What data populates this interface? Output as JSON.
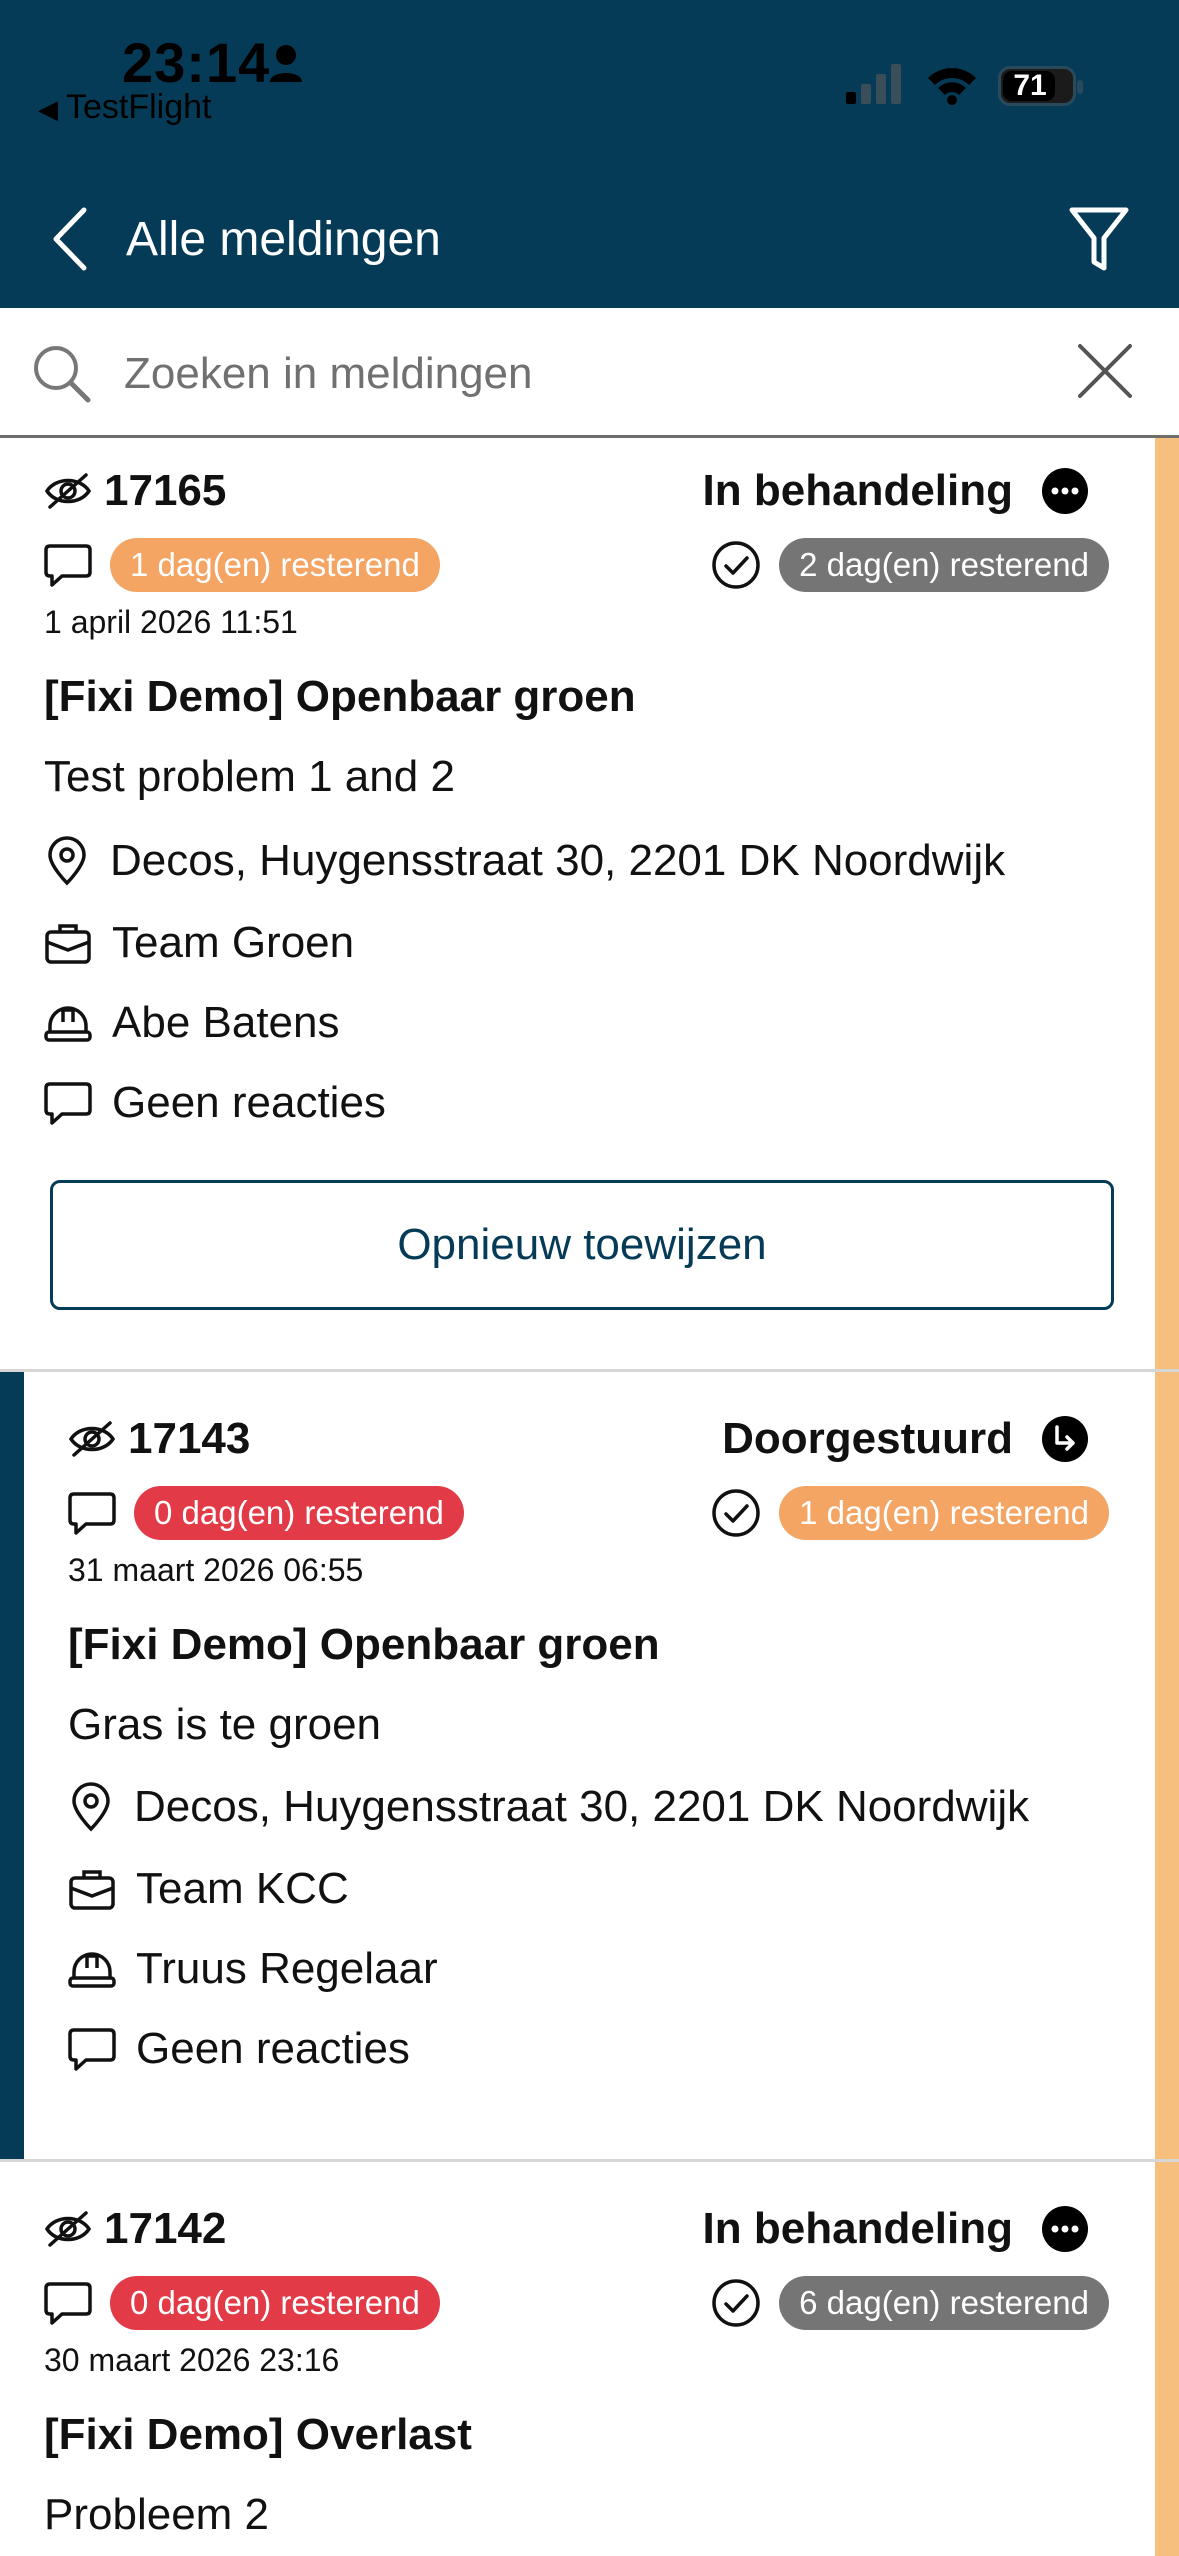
{
  "status_bar": {
    "time": "23:14",
    "back_app": "TestFlight",
    "battery": "71"
  },
  "nav": {
    "title": "Alle meldingen"
  },
  "search": {
    "placeholder": "Zoeken in meldingen"
  },
  "colors": {
    "header": "#053b57",
    "badge_orange": "#f4a463",
    "badge_red": "#e23b47",
    "badge_gray": "#757575",
    "side_orange": "#f7bf7d",
    "side_navy": "#053b57"
  },
  "cards": [
    {
      "id": "17165",
      "status": "In behandeling",
      "status_icon": "more-dots-icon",
      "deadline_left": "1 dag(en) resterend",
      "deadline_right": "2 dag(en) resterend",
      "date": "1 april 2026 11:51",
      "title": "[Fixi Demo] Openbaar groen",
      "description": "Test problem 1 and 2",
      "address": "Decos, Huygensstraat 30, 2201 DK Noordwijk",
      "team": "Team Groen",
      "assignee": "Abe Batens",
      "reactions": "Geen reacties",
      "action": "Opnieuw toewijzen"
    },
    {
      "id": "17143",
      "status": "Doorgestuurd",
      "status_icon": "forward-arrow-icon",
      "deadline_left": "0 dag(en) resterend",
      "deadline_right": "1 dag(en) resterend",
      "date": "31 maart 2026 06:55",
      "title": "[Fixi Demo] Openbaar groen",
      "description": "Gras is te groen",
      "address": "Decos, Huygensstraat 30, 2201 DK Noordwijk",
      "team": "Team KCC",
      "assignee": "Truus Regelaar",
      "reactions": "Geen reacties"
    },
    {
      "id": "17142",
      "status": "In behandeling",
      "status_icon": "more-dots-icon",
      "deadline_left": "0 dag(en) resterend",
      "deadline_right": "6 dag(en) resterend",
      "date": "30 maart 2026 23:16",
      "title": "[Fixi Demo] Overlast",
      "description": "Probleem 2"
    }
  ]
}
